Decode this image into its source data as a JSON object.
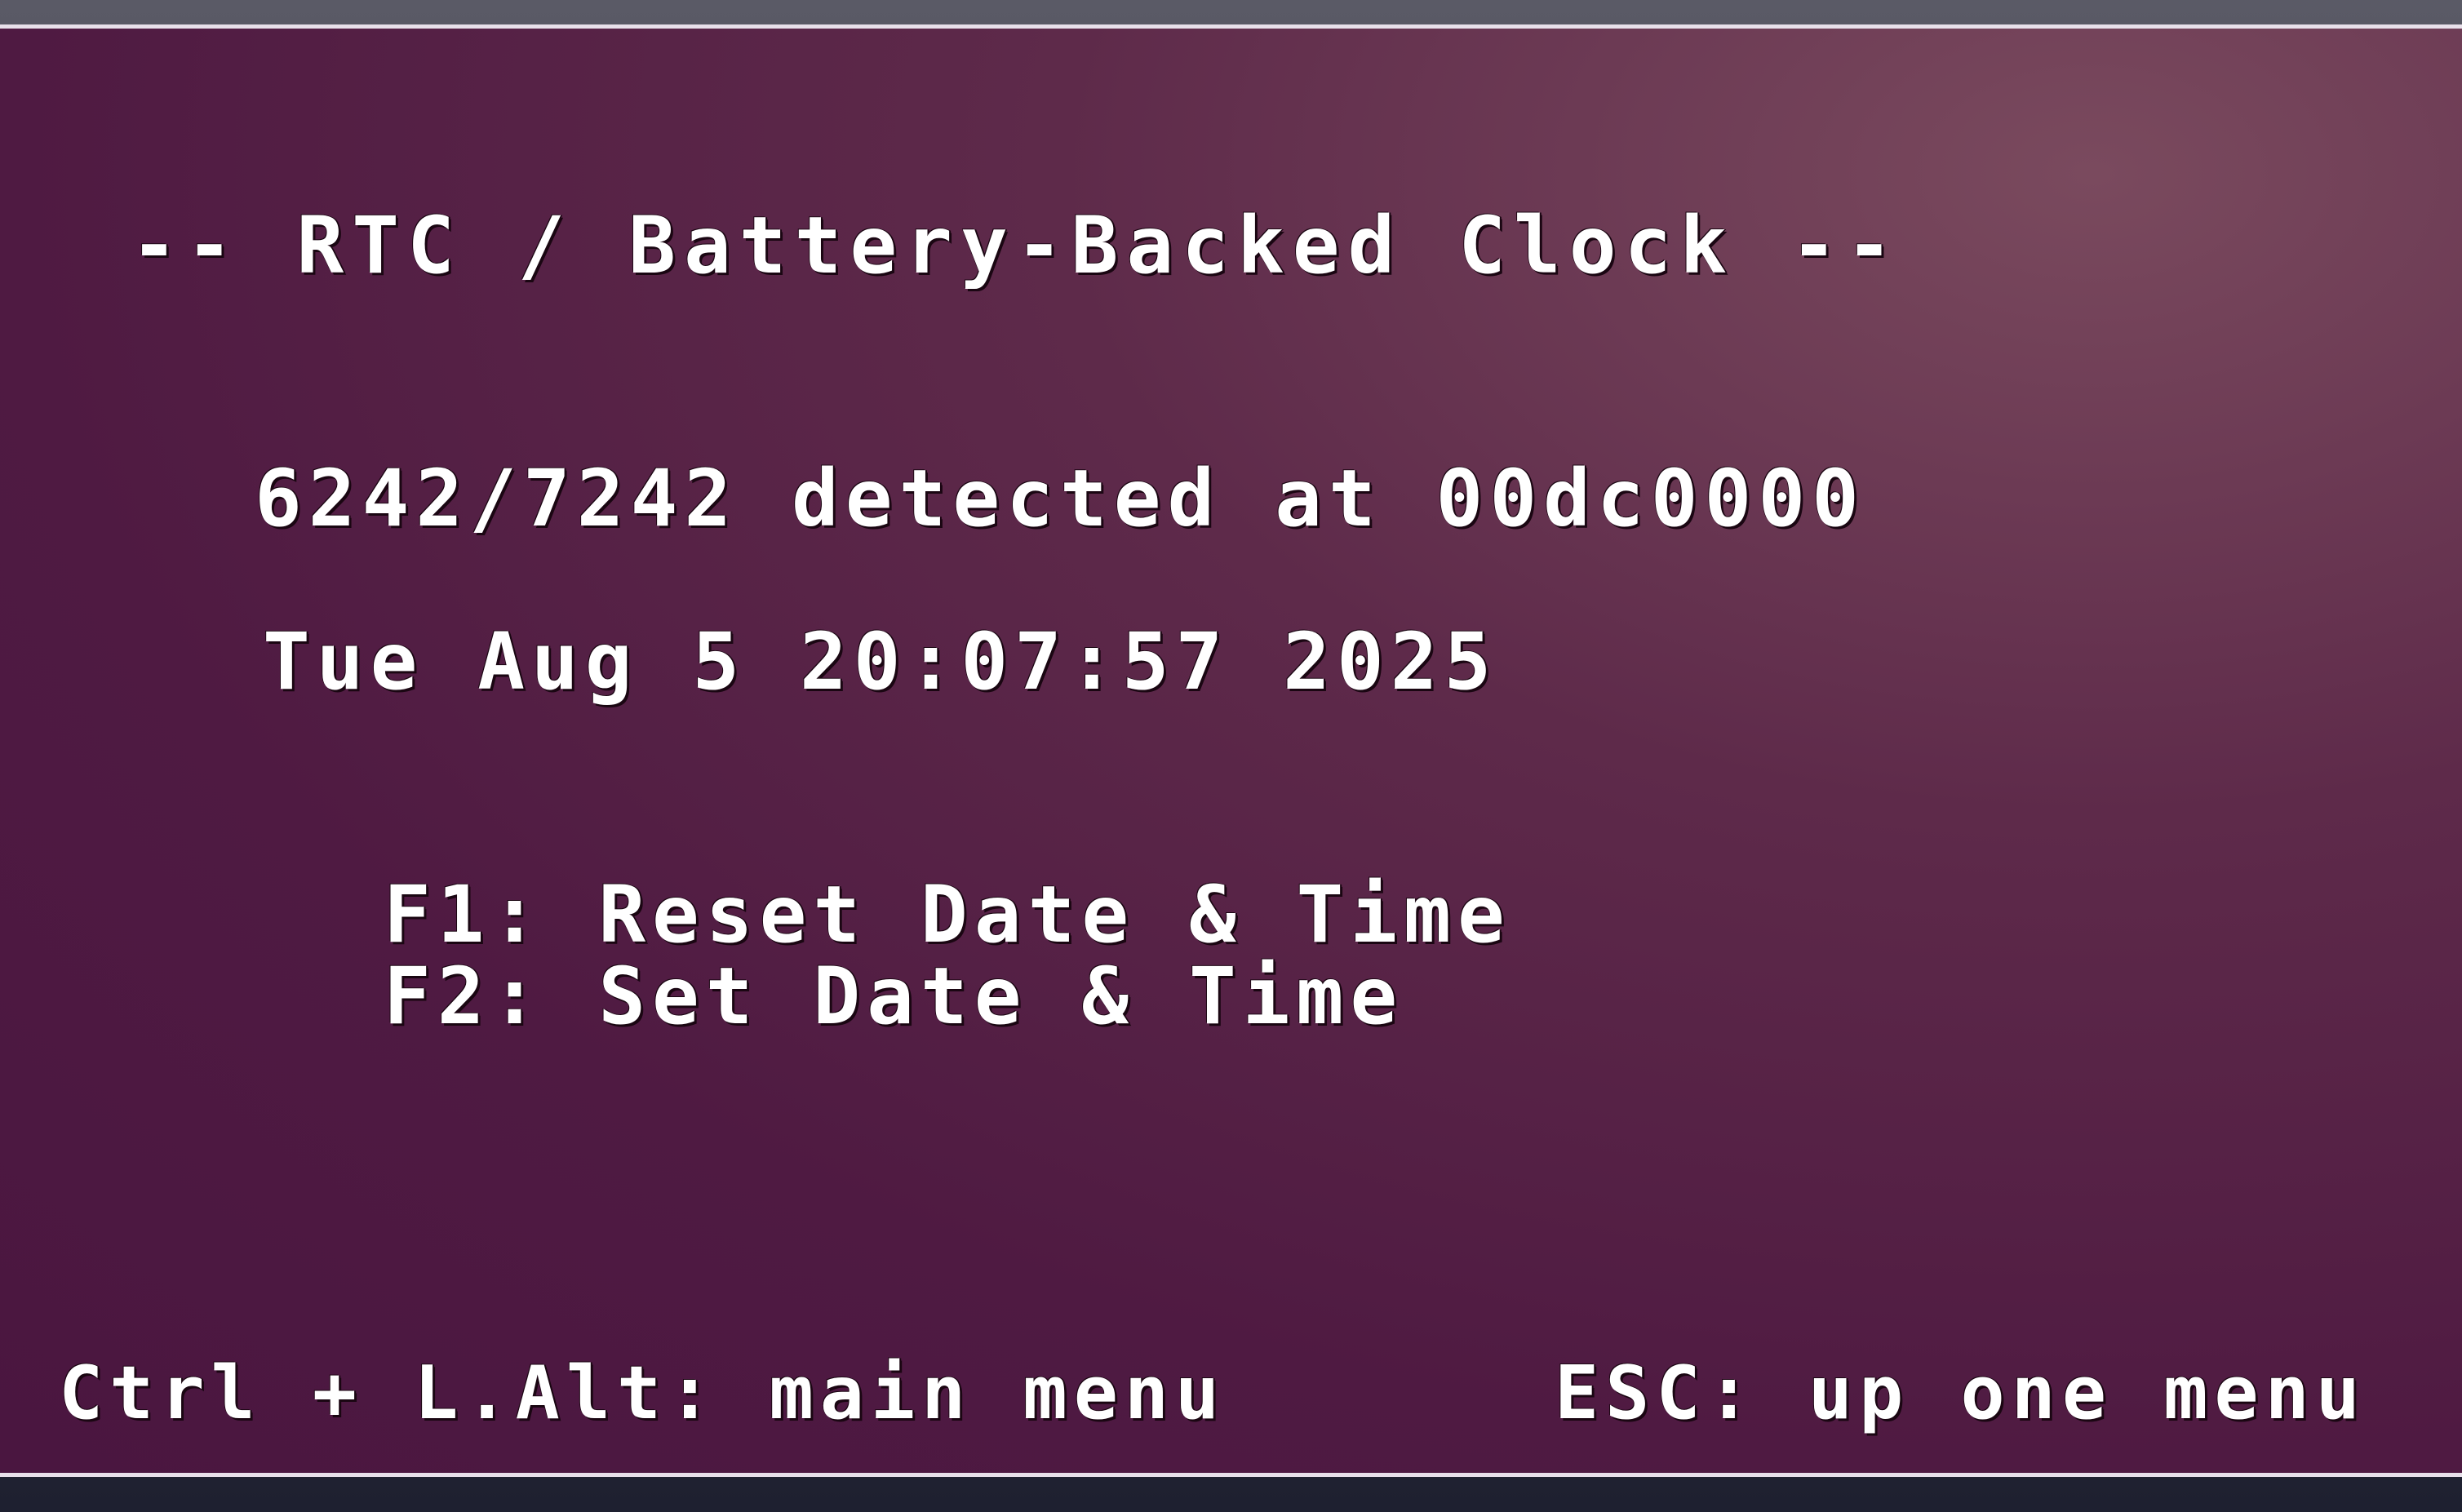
{
  "header": {
    "title": "-- RTC / Battery-Backed Clock --"
  },
  "status": {
    "detection": "6242/7242 detected at 00dc0000",
    "datetime": "Tue Aug 5 20:07:57 2025"
  },
  "menu": {
    "items": [
      {
        "label": "F1: Reset Date & Time"
      },
      {
        "label": "F2: Set Date & Time"
      }
    ]
  },
  "footer": {
    "main_menu_hint": "Ctrl + L.Alt: main menu",
    "up_menu_hint": "ESC: up one menu"
  },
  "colors": {
    "background": "#4f1a42",
    "text": "#ffffff"
  }
}
